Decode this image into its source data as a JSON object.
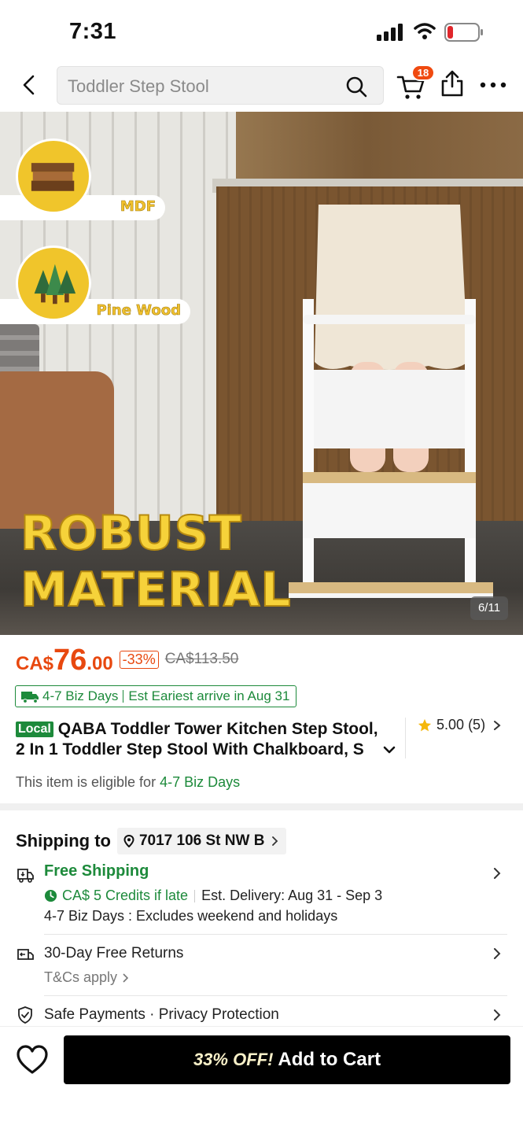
{
  "status_bar": {
    "time": "7:31"
  },
  "header": {
    "search_text": "Toddler Step Stool",
    "cart_count": "18",
    "icons": [
      "back-arrow-icon",
      "search-icon",
      "cart-icon",
      "share-icon",
      "more-icon"
    ]
  },
  "gallery": {
    "material_labels": [
      "MDF",
      "Pine Wood"
    ],
    "headline_line1": "ROBUST",
    "headline_line2": "MATERIAL",
    "pager": "6/11"
  },
  "price": {
    "currency": "CA$",
    "whole": "76",
    "cents": ".00",
    "discount": "-33%",
    "original": "CA$113.50"
  },
  "delivery_chip": {
    "days": "4-7 Biz Days",
    "arrive": "Est Eariest arrive in Aug 31"
  },
  "product": {
    "local_badge": "Local",
    "title_line1": "QABA Toddler Tower Kitchen Step Stool,",
    "title_line2": "2 In 1 Toddler Step Stool With Chalkboard, S",
    "rating": "5.00",
    "rating_count": "(5)"
  },
  "eligibility": {
    "prefix": "This item is eligible for ",
    "days": "4-7 Biz Days"
  },
  "shipping": {
    "label": "Shipping to",
    "address": "7017 106 St NW B",
    "free_label": "Free Shipping",
    "credits": "CA$ 5 Credits if late",
    "est_delivery": "Est. Delivery: Aug 31 - Sep 3",
    "biz_days_note": "4-7 Biz Days : Excludes weekend and holidays"
  },
  "returns": {
    "label": "30-Day Free Returns",
    "terms": "T&Cs apply"
  },
  "payments": {
    "label": "Safe Payments · Privacy Protection"
  },
  "bottom_bar": {
    "off_label": "33% OFF!",
    "cta_label": "Add to Cart"
  },
  "colors": {
    "price_orange": "#e8480f",
    "green": "#1d8a3b",
    "cta_black": "#000000",
    "headline_yellow": "#f6d23a"
  }
}
